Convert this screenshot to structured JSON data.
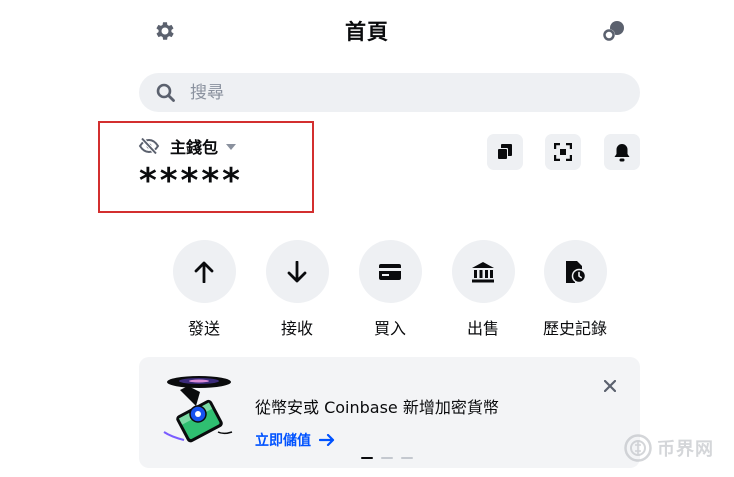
{
  "header": {
    "title": "首頁",
    "left_icon": "gear-icon",
    "right_icon": "connect-icon"
  },
  "search": {
    "placeholder": "搜尋",
    "icon": "search-icon"
  },
  "wallet": {
    "name": "主錢包",
    "balance": "*****",
    "visibility_icon": "eye-off-icon",
    "dropdown_icon": "caret-down-icon"
  },
  "toolbar": {
    "icons": [
      "copy-icon",
      "scan-icon",
      "bell-icon"
    ]
  },
  "actions": [
    {
      "label": "發送",
      "icon": "arrow-up-icon"
    },
    {
      "label": "接收",
      "icon": "arrow-down-icon"
    },
    {
      "label": "買入",
      "icon": "card-icon"
    },
    {
      "label": "出售",
      "icon": "bank-icon"
    },
    {
      "label": "歷史記錄",
      "icon": "history-icon"
    }
  ],
  "promo": {
    "title": "從幣安或 Coinbase 新增加密貨幣",
    "link": "立即儲值",
    "link_icon": "arrow-right-icon",
    "close_icon": "close-icon",
    "pages": 3,
    "active_page": 1
  },
  "watermark": {
    "text": "币界网"
  },
  "colors": {
    "text": "#0a0b0d",
    "surface": "#eef0f3",
    "accent": "#0052ff",
    "highlight_border": "#d32f2f"
  }
}
